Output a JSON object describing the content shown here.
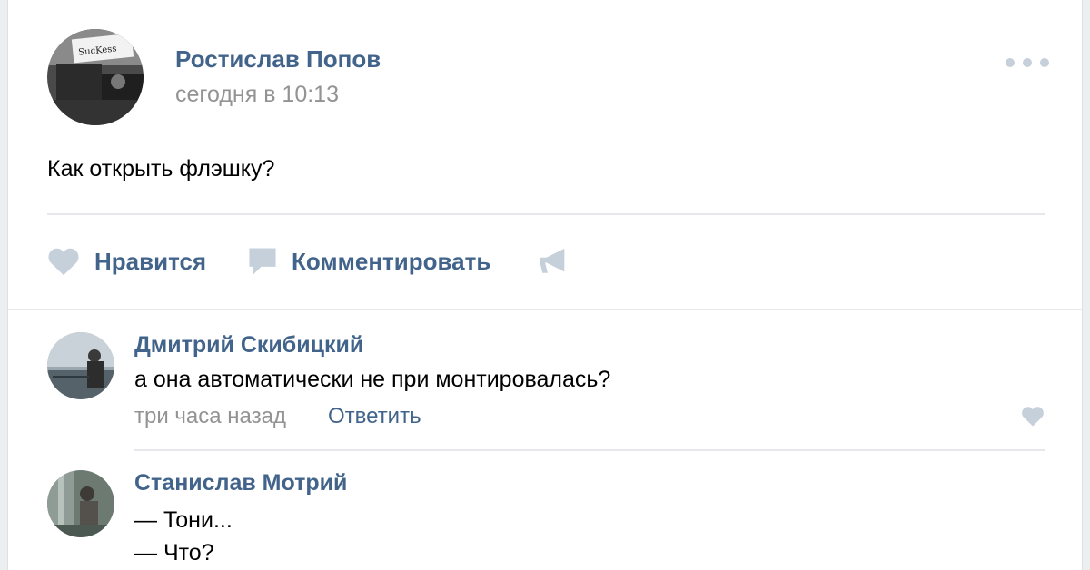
{
  "post": {
    "author": "Ростислав Попов",
    "time": "сегодня в 10:13",
    "text": "Как открыть флэшку?",
    "avatar_sign": "SucKess",
    "actions": {
      "like": "Нравится",
      "comment": "Комментировать"
    }
  },
  "comments": [
    {
      "author": "Дмитрий Скибицкий",
      "text": "а она автоматически не при монтировалась?",
      "time": "три часа назад",
      "reply": "Ответить"
    },
    {
      "author": "Станислав Мотрий",
      "lines": [
        "— Тони...",
        "— Что?"
      ]
    }
  ],
  "colors": {
    "link": "#42648b",
    "muted": "#939393",
    "icon": "#c5d0db",
    "divider": "#e7e8ec"
  },
  "icons": {
    "like": "heart-icon",
    "comment": "speech-bubble-icon",
    "share": "megaphone-icon",
    "more": "more-dots-icon"
  }
}
